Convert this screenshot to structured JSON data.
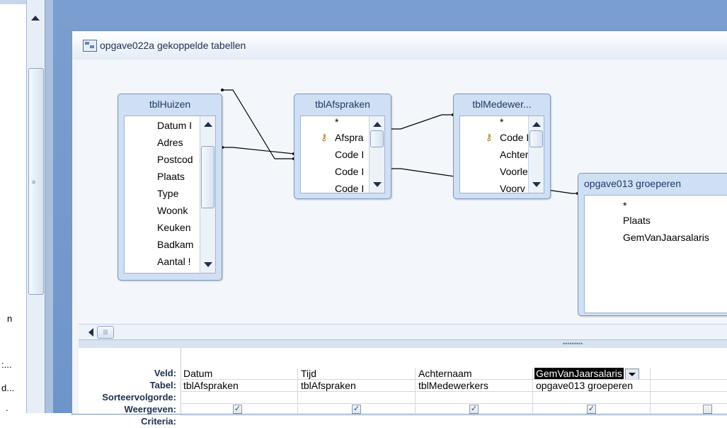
{
  "nav": {
    "stub_items": [
      "n",
      ":...",
      "d...",
      "."
    ]
  },
  "query_window": {
    "title": "opgave022a gekoppelde tabellen",
    "tables": [
      {
        "name": "tblHuizen",
        "fields": [
          "Datum I",
          "Adres",
          "Postcod",
          "Plaats",
          "Type",
          "Woonk",
          "Keuken",
          "Badkam",
          "Aantal !"
        ]
      },
      {
        "name": "tblAfspraken",
        "fields": [
          "*",
          "Afspra",
          "Code I",
          "Code I",
          "Code I"
        ],
        "key_field": 1
      },
      {
        "name": "tblMedewer...",
        "fields": [
          "*",
          "Code I",
          "Achter",
          "Voorle",
          "Voorv"
        ],
        "key_field": 1
      },
      {
        "name": "opgave013 groeperen",
        "fields": [
          "*",
          "Plaats",
          "GemVanJaarsalaris"
        ]
      }
    ]
  },
  "design_grid": {
    "row_labels": [
      "Veld:",
      "Tabel:",
      "Sorteervolgorde:",
      "Weergeven:",
      "Criteria:"
    ],
    "columns": [
      {
        "veld": "Datum",
        "tabel": "tblAfspraken",
        "weergeven": true
      },
      {
        "veld": "Tijd",
        "tabel": "tblAfspraken",
        "weergeven": true
      },
      {
        "veld": "Achternaam",
        "tabel": "tblMedewerkers",
        "weergeven": true
      },
      {
        "veld": "GemVanJaarsalaris",
        "tabel": "opgave013 groeperen",
        "weergeven": true,
        "selected": true
      },
      {
        "veld": "",
        "tabel": "",
        "weergeven": false
      }
    ]
  },
  "colors": {
    "workspace": "#7b9ed0",
    "table_header": "#cfdff4",
    "selection": "#000000"
  }
}
